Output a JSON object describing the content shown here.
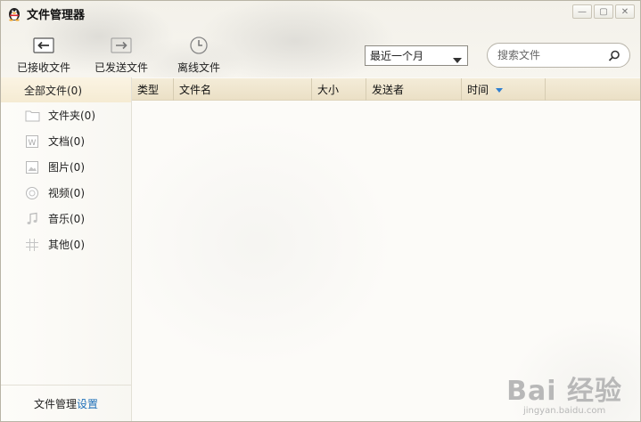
{
  "window": {
    "title": "文件管理器",
    "controls": {
      "minimize": "—",
      "maximize": "▢",
      "close": "✕"
    }
  },
  "toolbar": {
    "received_label": "已接收文件",
    "sent_label": "已发送文件",
    "offline_label": "离线文件"
  },
  "filter": {
    "selected": "最近一个月"
  },
  "search": {
    "placeholder": "搜索文件"
  },
  "sidebar": {
    "all_label": "全部文件(0)",
    "items": [
      {
        "label": "文件夹(0)",
        "icon": "folder-icon"
      },
      {
        "label": "文档(0)",
        "icon": "document-icon"
      },
      {
        "label": "图片(0)",
        "icon": "image-icon"
      },
      {
        "label": "视频(0)",
        "icon": "video-icon"
      },
      {
        "label": "音乐(0)",
        "icon": "music-icon"
      },
      {
        "label": "其他(0)",
        "icon": "grid-icon"
      }
    ],
    "footer_text": "文件管理",
    "footer_link": "设置"
  },
  "table": {
    "columns": [
      "类型",
      "文件名",
      "大小",
      "发送者",
      "时间"
    ]
  },
  "watermark": {
    "main": "Bai 经验",
    "sub": "jingyan.baidu.com"
  }
}
